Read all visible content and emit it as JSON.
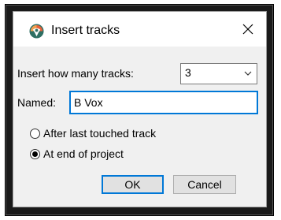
{
  "dialog": {
    "title": "Insert tracks",
    "icon": "reaper-logo-icon",
    "close_icon": "close-icon"
  },
  "form": {
    "count_label": "Insert how many tracks:",
    "count_value": "3",
    "name_label": "Named:",
    "name_value": "B Vox",
    "radio_options": [
      {
        "label": "After last touched track",
        "checked": false
      },
      {
        "label": "At end of project",
        "checked": true
      }
    ]
  },
  "buttons": {
    "ok_label": "OK",
    "cancel_label": "Cancel"
  },
  "colors": {
    "accent": "#0078d7",
    "dialog_bg": "#f0f0f0",
    "titlebar_bg": "#ffffff"
  }
}
